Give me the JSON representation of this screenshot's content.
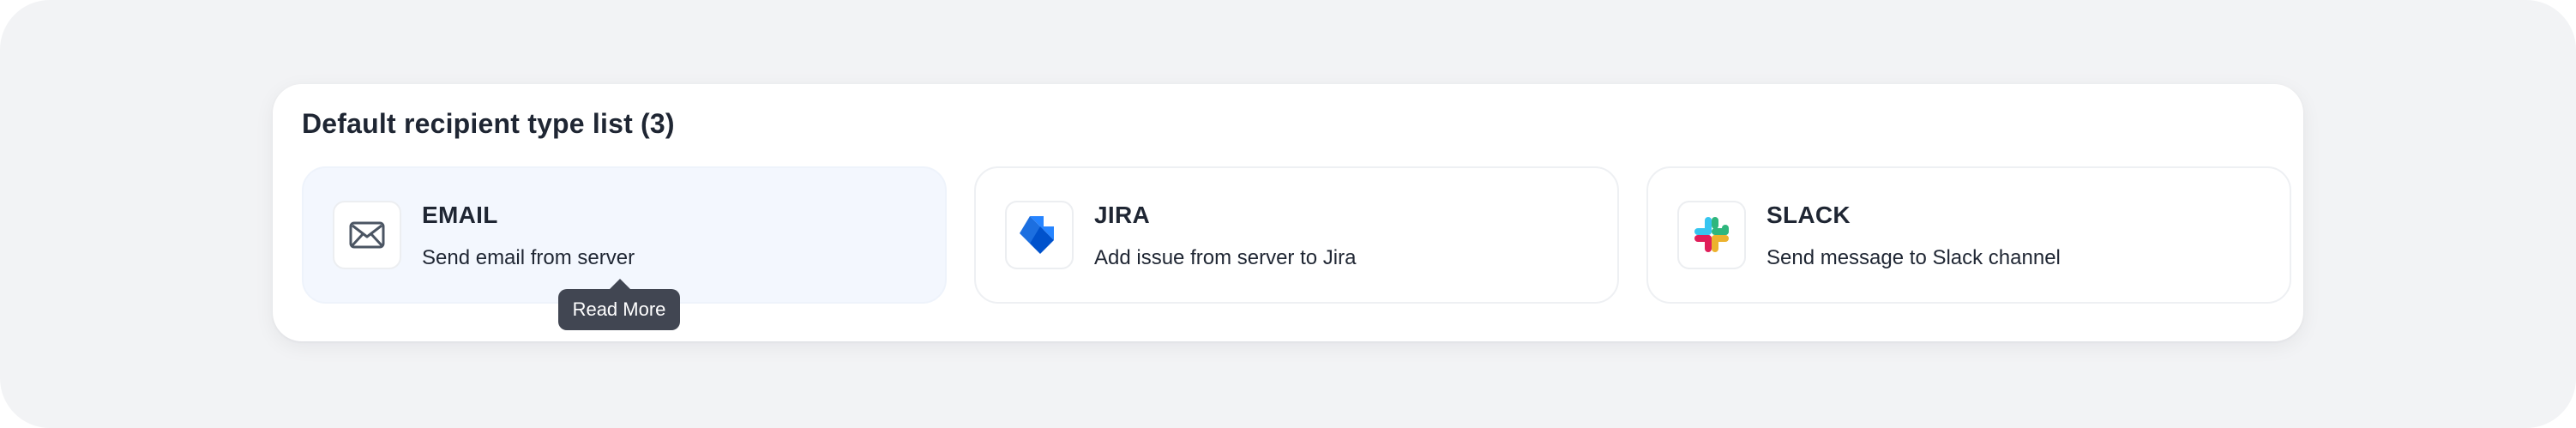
{
  "section": {
    "title": "Default recipient type list (3)"
  },
  "recipient_types": [
    {
      "title": "EMAIL",
      "description": "Send email from server",
      "icon": "mail-icon",
      "selected": true
    },
    {
      "title": "JIRA",
      "description": "Add issue from server to Jira",
      "icon": "jira-logo-icon",
      "selected": false
    },
    {
      "title": "SLACK",
      "description": "Send message to Slack channel",
      "icon": "slack-logo-icon",
      "selected": false
    }
  ],
  "tooltip": {
    "text": "Read More"
  },
  "colors": {
    "background": "#f2f3f5",
    "panel": "#ffffff",
    "selected_card": "#f3f7fe",
    "text": "#1f2633",
    "tooltip": "#414652",
    "jira_blue": "#2684ff",
    "slack_blue": "#36c5f0",
    "slack_green": "#2eb67d",
    "slack_yellow": "#ecb22e",
    "slack_red": "#e01e5a"
  }
}
